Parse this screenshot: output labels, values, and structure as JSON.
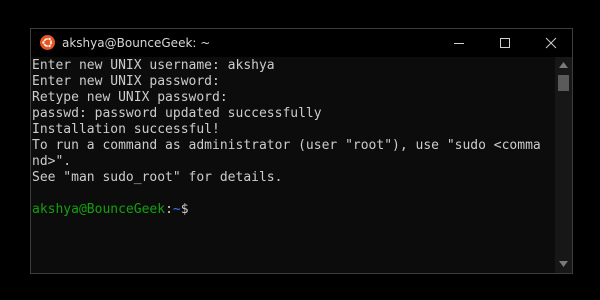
{
  "window": {
    "title": "akshya@BounceGeek: ~",
    "app_icon": "ubuntu-logo-icon",
    "controls": {
      "minimize_icon": "minimize-icon",
      "maximize_icon": "maximize-icon",
      "close_icon": "close-icon"
    }
  },
  "terminal": {
    "lines": [
      "Enter new UNIX username: akshya",
      "Enter new UNIX password:",
      "Retype new UNIX password:",
      "passwd: password updated successfully",
      "Installation successful!",
      "To run a command as administrator (user \"root\"), use \"sudo <comma",
      "nd>\".",
      "See \"man sudo_root\" for details.",
      ""
    ],
    "prompt": {
      "user_host": "akshya@BounceGeek",
      "separator": ":",
      "path": "~",
      "symbol": "$"
    }
  },
  "colors": {
    "titlebar_bg": "#000000",
    "terminal_bg": "#0c0c0c",
    "terminal_text": "#cccccc",
    "prompt_user": "#13a10e",
    "prompt_path": "#3b78ff",
    "ubuntu_orange": "#e95420"
  },
  "scrollbar": {
    "up_icon": "arrow-up-icon",
    "down_icon": "arrow-down-icon"
  }
}
